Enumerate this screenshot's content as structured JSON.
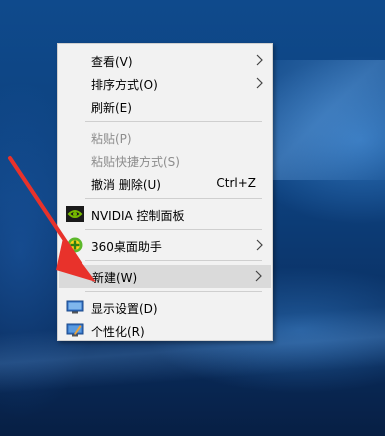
{
  "menu": {
    "items": [
      {
        "label": "查看(V)",
        "has_submenu": true
      },
      {
        "label": "排序方式(O)",
        "has_submenu": true
      },
      {
        "label": "刷新(E)"
      },
      {
        "label": "粘贴(P)",
        "disabled": true
      },
      {
        "label": "粘贴快捷方式(S)",
        "disabled": true
      },
      {
        "label": "撤消 删除(U)",
        "shortcut": "Ctrl+Z"
      },
      {
        "label": "NVIDIA 控制面板",
        "icon": "nvidia-icon"
      },
      {
        "label": "360桌面助手",
        "icon": "360-icon",
        "has_submenu": true
      },
      {
        "label": "新建(W)",
        "has_submenu": true,
        "highlighted": true
      },
      {
        "label": "显示设置(D)",
        "icon": "display-icon"
      },
      {
        "label": "个性化(R)",
        "icon": "personalize-icon"
      }
    ]
  },
  "colors": {
    "menu_bg": "#f2f2f2",
    "highlight_bg": "#dadada",
    "disabled_text": "#8d8d8d",
    "annotation_arrow": "#e8322b"
  }
}
